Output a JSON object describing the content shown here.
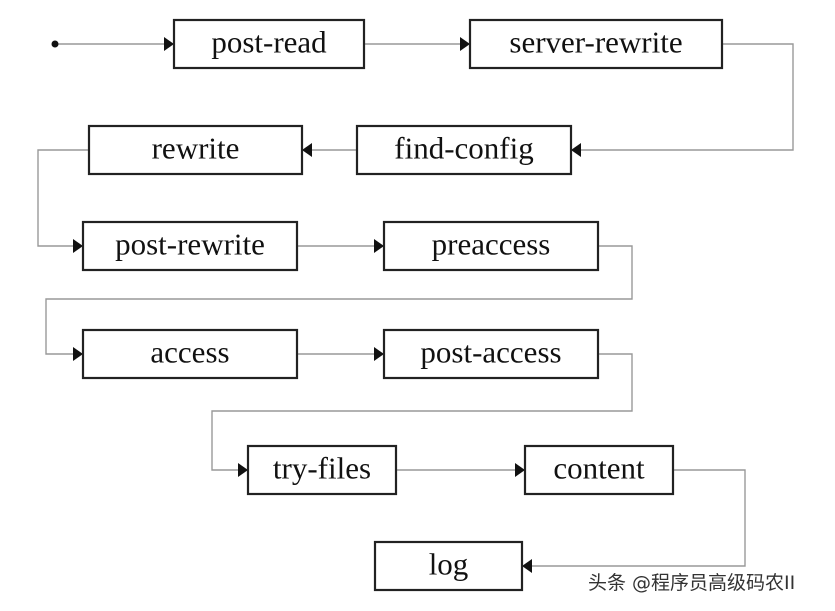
{
  "diagram": {
    "nodes": [
      {
        "id": "post-read",
        "label": "post-read"
      },
      {
        "id": "server-rewrite",
        "label": "server-rewrite"
      },
      {
        "id": "find-config",
        "label": "find-config"
      },
      {
        "id": "rewrite",
        "label": "rewrite"
      },
      {
        "id": "post-rewrite",
        "label": "post-rewrite"
      },
      {
        "id": "preaccess",
        "label": "preaccess"
      },
      {
        "id": "access",
        "label": "access"
      },
      {
        "id": "post-access",
        "label": "post-access"
      },
      {
        "id": "try-files",
        "label": "try-files"
      },
      {
        "id": "content",
        "label": "content"
      },
      {
        "id": "log",
        "label": "log"
      }
    ],
    "edges": [
      [
        "start",
        "post-read"
      ],
      [
        "post-read",
        "server-rewrite"
      ],
      [
        "server-rewrite",
        "find-config"
      ],
      [
        "find-config",
        "rewrite"
      ],
      [
        "rewrite",
        "post-rewrite"
      ],
      [
        "post-rewrite",
        "preaccess"
      ],
      [
        "preaccess",
        "access"
      ],
      [
        "access",
        "post-access"
      ],
      [
        "post-access",
        "try-files"
      ],
      [
        "try-files",
        "content"
      ],
      [
        "content",
        "log"
      ]
    ]
  },
  "watermark": "头条 @程序员高级码农II"
}
